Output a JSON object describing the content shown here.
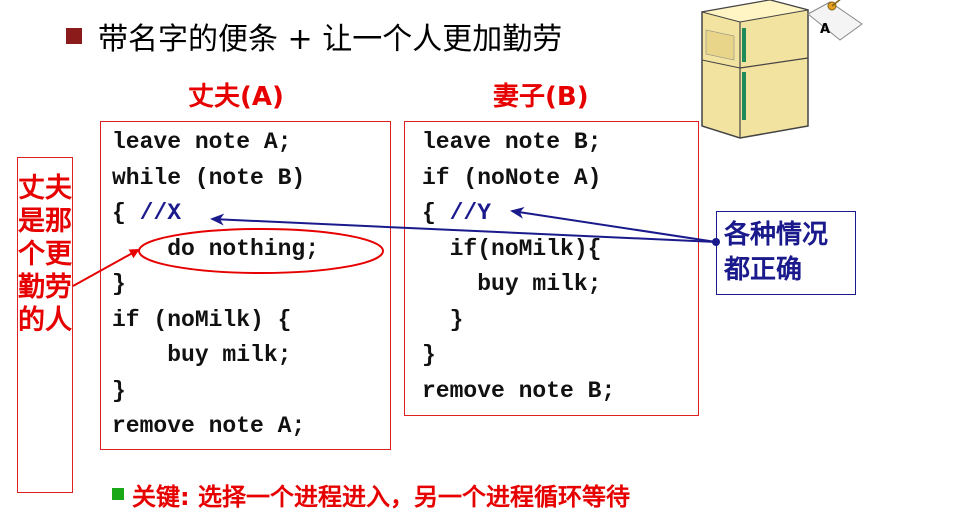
{
  "title": "带名字的便条 + 让一个人更加勤劳",
  "husband": {
    "label": "丈夫(A)",
    "code": [
      "leave note A;",
      "while (note B)",
      "{ //X",
      "    do nothing;",
      "}",
      "if (noMilk) {",
      "    buy milk;",
      "}",
      "remove note A;"
    ]
  },
  "wife": {
    "label": "妻子(B)",
    "code": [
      "leave note B;",
      "if (noNote A)",
      "{ //Y",
      "  if(noMilk){",
      "    buy milk;",
      "  }",
      "}",
      "remove note B;"
    ]
  },
  "side_note": "丈夫是那个更勤劳的人",
  "callout": {
    "line1": "各种情况",
    "line2": "都正确"
  },
  "key_point": "关键: 选择一个进程进入，另一个进程循环等待",
  "fridge_note_letter": "A",
  "colors": {
    "red": "#e60000",
    "navy": "#1a1a8c",
    "bullet_title": "#8b1a1a",
    "bullet_key": "#18a818"
  }
}
